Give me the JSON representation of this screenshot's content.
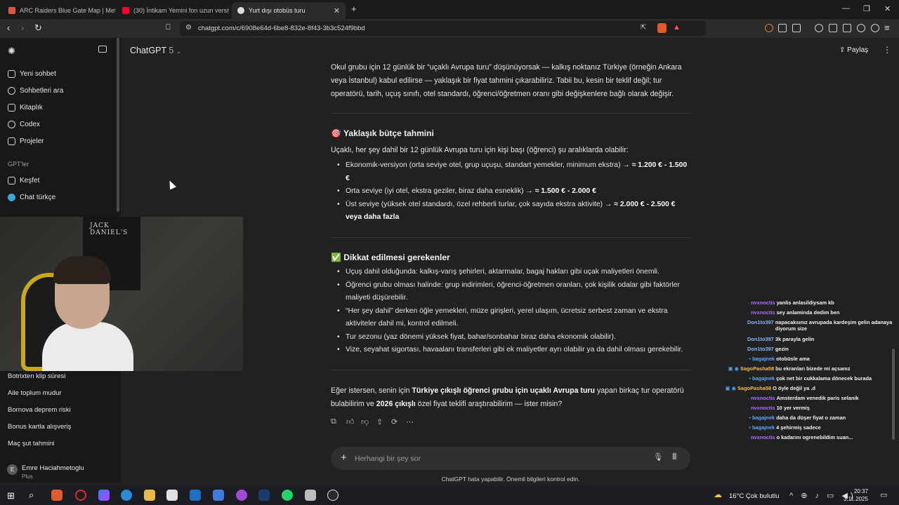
{
  "browser": {
    "tabs": [
      {
        "title": "ARC Raiders Blue Gate Map | MetaFo",
        "favicon_color": "#e2583e"
      },
      {
        "title": "(30) İntikam Yemini fon uzun versiyon",
        "favicon_color": "#ff0033"
      },
      {
        "title": "Yurt dışı otobüs turu",
        "favicon_color": "#dddddd"
      }
    ],
    "new_tab": "+",
    "url": "chatgpt.com/c/6908e64d-6be8-832e-8f43-3b3c524f9bbd",
    "window_controls": {
      "minimize": "—",
      "maximize": "❐",
      "close": "✕"
    }
  },
  "sidebar": {
    "nav": [
      {
        "label": "Yeni sohbet",
        "icon": "edit-icon"
      },
      {
        "label": "Sohbetleri ara",
        "icon": "search-icon"
      },
      {
        "label": "Kitaplık",
        "icon": "library-icon"
      },
      {
        "label": "Codex",
        "icon": "codex-icon"
      },
      {
        "label": "Projeler",
        "icon": "folder-icon"
      }
    ],
    "gpts_section": "GPT'ler",
    "gpts": [
      {
        "label": "Keşfet",
        "icon": "grid-icon"
      },
      {
        "label": "Chat türkçe",
        "icon": "gpt-avatar-icon"
      }
    ],
    "chats": [
      "Botrixten klip süresi",
      "Aile toplum mudur",
      "Bornova deprem riski",
      "Bonus kartla alışveriş",
      "Maç şut tahmini"
    ],
    "user": {
      "initial": "E",
      "name": "Emre Haciahmetoglu",
      "plan": "Plus"
    }
  },
  "webcam": {
    "poster_text": "JACK DANIEL'S"
  },
  "header": {
    "model": "ChatGPT",
    "version": "5",
    "share_label": "Paylaş"
  },
  "message": {
    "intro": "Okul grubu için 12 günlük bir “uçaklı Avrupa turu” düşünüyorsak — kalkış noktanız Türkiye (örneğin Ankara veya İstanbul) kabul edilirse — yaklaşık bir fiyat tahmini çıkarabiliriz. Tabii bu, kesin bir teklif değil; tur operatörü, tarih, uçuş sınıfı, otel standardı, öğrenci/öğretmen oranı gibi değişkenlere bağlı olarak değişir.",
    "budget_heading": "🎯 Yaklaşık bütçe tahmini",
    "budget_intro": "Uçaklı, her şey dahil bir 12 günlük Avrupa turu için kişi başı (öğrenci) şu aralıklarda olabilir:",
    "budget_items": [
      {
        "text": "Ekonomik-versiyon (orta seviye otel, grup uçuşu, standart yemekler, minimum ekstra) → ",
        "bold": "≈ 1.200 € - 1.500 €"
      },
      {
        "text": "Orta seviye (iyi otel, ekstra geziler, biraz daha esneklik) → ",
        "bold": "≈ 1.500 € - 2.000 €"
      },
      {
        "text": "Üst seviye (yüksek otel standardı, özel rehberli turlar, çok sayıda ekstra aktivite) → ",
        "bold": "≈ 2.000 € - 2.500 € veya daha fazla"
      }
    ],
    "attention_heading": "✅ Dikkat edilmesi gerekenler",
    "attention_items": [
      "Uçuş dahil olduğunda: kalkış-varış şehirleri, aktarmalar, bagaj hakları gibi uçak maliyetleri önemli.",
      "Öğrenci grubu olması halinde: grup indirimleri, öğrenci-öğretmen oranları, çok kişilik odalar gibi faktörler maliyeti düşürebilir.",
      "“Her şey dahil” derken öğle yemekleri, müze girişleri, yerel ulaşım, ücretsiz serbest zaman ve ekstra aktiviteler dahil mi, kontrol edilmeli.",
      "Tur sezonu (yaz dönemi yüksek fiyat, bahar/sonbahar biraz daha ekonomik olabilir).",
      "Vize, seyahat sigortası, havaalanı transferleri gibi ek maliyetler ayrı olabilir ya da dahil olması gerekebilir."
    ],
    "closing_parts": [
      "Eğer istersen, senin için ",
      "Türkiye çıkışlı öğrenci grubu için uçaklı Avrupa turu",
      " yapan birkaç tur operatörü bulabilirim ve ",
      "2026 çıkışlı",
      " özel fiyat teklifi araştırabilirim — ister misin?"
    ],
    "action_icons": [
      "copy-icon",
      "thumbs-up-icon",
      "thumbs-down-icon",
      "share-icon",
      "regenerate-icon",
      "more-icon"
    ]
  },
  "composer": {
    "placeholder": "Herhangi bir şey sor",
    "plus": "+",
    "mic": "🎙",
    "voice": "▮▮"
  },
  "disclaimer": "ChatGPT hata yapabilir. Önemli bilgileri kontrol edin.",
  "chat_overlay": [
    {
      "user": "nvxnoctis",
      "msg": "yanlis anlasildiysam kb",
      "color": "#b46cff",
      "badges": "·"
    },
    {
      "user": "nvxnoctis",
      "msg": "sey anlaminda dedim ben",
      "color": "#b46cff",
      "badges": "·"
    },
    {
      "user": "Don1to397",
      "msg": "napacaksınız avrupada kardeşim gelin adanaya diyorum size",
      "color": "#8ab4f8",
      "badges": ""
    },
    {
      "user": "Don1to397",
      "msg": "3k parayla gelin",
      "color": "#8ab4f8",
      "badges": ""
    },
    {
      "user": "Don1to397",
      "msg": "gezin",
      "color": "#8ab4f8",
      "badges": ""
    },
    {
      "user": "bagajnek",
      "msg": "otobüsle ama",
      "color": "#5aa9ff",
      "badges": "•"
    },
    {
      "user": "SagoPasha58",
      "msg": "bu ekranları bizede mi açsanız",
      "color": "#ffb84d",
      "badges": "▣ ◉"
    },
    {
      "user": "bagajnek",
      "msg": "çok net bir cukkalama dönecek burada",
      "color": "#5aa9ff",
      "badges": "•"
    },
    {
      "user": "SagoPasha58",
      "msg": "O öyle değil ya .d",
      "color": "#ffb84d",
      "badges": "▣ ◉"
    },
    {
      "user": "nvxnoctis",
      "msg": "Amsterdam venedik paris selanik",
      "color": "#b46cff",
      "badges": "·"
    },
    {
      "user": "nvxnoctis",
      "msg": "10 yer vermiş",
      "color": "#b46cff",
      "badges": "·"
    },
    {
      "user": "bagajnek",
      "msg": "daha da düşer fiyat o zaman",
      "color": "#5aa9ff",
      "badges": "•"
    },
    {
      "user": "bagajnek",
      "msg": "4 şehirmiş sadece",
      "color": "#5aa9ff",
      "badges": "•"
    },
    {
      "user": "nvxnoctis",
      "msg": "o kadarını ogrenebildim suan...",
      "color": "#b46cff",
      "badges": "·"
    }
  ],
  "taskbar": {
    "weather": "16°C  Çok bulutlu",
    "time": "20:37",
    "date": "3.11.2025",
    "tray": "^ ⊕ ♪ ▭ ◀)"
  }
}
